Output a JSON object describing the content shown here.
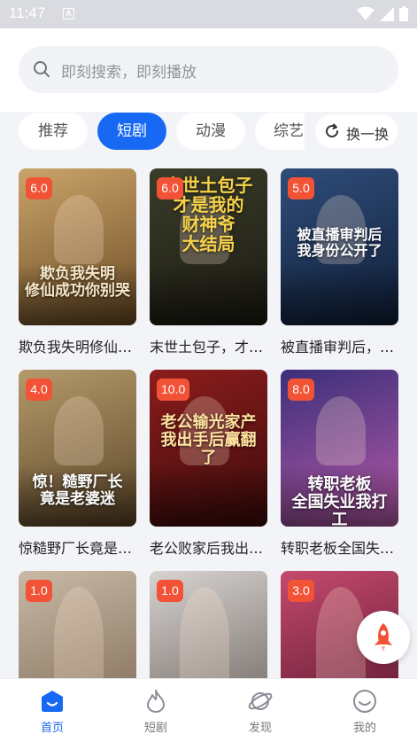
{
  "status_bar": {
    "time": "11:47",
    "notification_letter": "A"
  },
  "search": {
    "placeholder": "即刻搜索，即刻播放"
  },
  "tabs": [
    {
      "label": "推荐",
      "active": false
    },
    {
      "label": "短剧",
      "active": true
    },
    {
      "label": "动漫",
      "active": false
    },
    {
      "label": "综艺",
      "active": false
    }
  ],
  "swap_button": {
    "label": "换一换"
  },
  "cards": [
    {
      "score": "6.0",
      "title": "欺负我失明修仙成功你别哭",
      "poster_text": "欺负我失明\n修仙成功你别哭",
      "poster_colors": [
        "#caa46a",
        "#6b4a24"
      ]
    },
    {
      "score": "6.0",
      "title": "末世土包子，才是我的财神爷",
      "poster_text": "末世土包子\n才是我的\n财神爷\n大结局",
      "poster_colors": [
        "#3a3d2a",
        "#1c1a12"
      ]
    },
    {
      "score": "5.0",
      "title": "被直播审判后，我身份公开了",
      "poster_text": "被直播审判后\n我身份公开了",
      "poster_colors": [
        "#2f4d7a",
        "#0f1e38"
      ]
    },
    {
      "score": "4.0",
      "title": "惊糙野厂长竟是老婆迷",
      "poster_text": "惊！糙野厂长\n竟是老婆迷",
      "poster_colors": [
        "#b49a6b",
        "#5a4426"
      ]
    },
    {
      "score": "10.0",
      "title": "老公败家后我出手后赢翻了",
      "poster_text": "老公输光家产\n我出手后赢翻了",
      "poster_colors": [
        "#8c1d1d",
        "#3d0a0a"
      ]
    },
    {
      "score": "8.0",
      "title": "转职老板全国失业我打工",
      "poster_text": "转职老板\n全国失业我打工",
      "poster_colors": [
        "#3b2f7a",
        "#b85aa8"
      ]
    },
    {
      "score": "1.0",
      "title": "",
      "poster_text": "",
      "poster_colors": [
        "#c9b9a6",
        "#7d6a55"
      ]
    },
    {
      "score": "1.0",
      "title": "",
      "poster_text": "",
      "poster_colors": [
        "#d7d3d0",
        "#6c6460"
      ]
    },
    {
      "score": "3.0",
      "title": "",
      "poster_text": "",
      "poster_colors": [
        "#c44a6d",
        "#5a1630"
      ]
    }
  ],
  "bottom_nav": [
    {
      "label": "首页",
      "icon": "home-icon",
      "active": true
    },
    {
      "label": "短剧",
      "icon": "flame-icon",
      "active": false
    },
    {
      "label": "发现",
      "icon": "planet-icon",
      "active": false
    },
    {
      "label": "我的",
      "icon": "smile-face-icon",
      "active": false
    }
  ],
  "colors": {
    "accent": "#1769f3",
    "score_badge": "#f25236",
    "float_rocket": "#f25236"
  }
}
